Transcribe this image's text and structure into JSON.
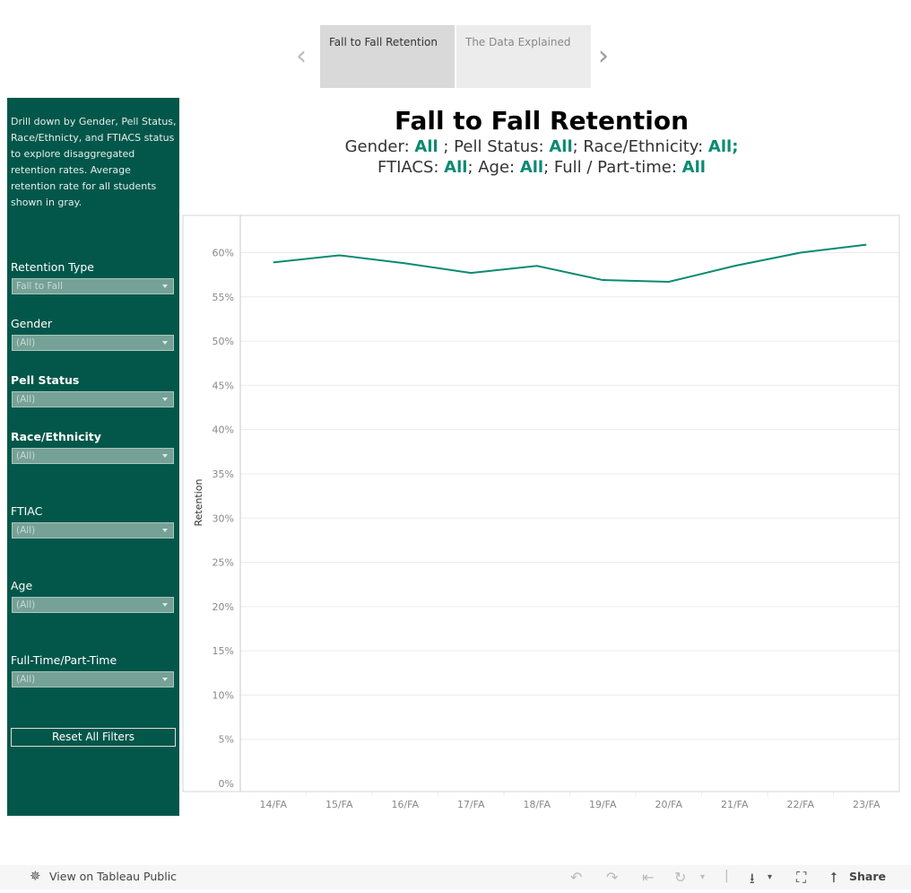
{
  "story": {
    "points": [
      {
        "label": "Fall to Fall Retention",
        "active": true
      },
      {
        "label": "The Data Explained",
        "active": false
      }
    ],
    "prev_icon": "chevron-left-icon",
    "next_icon": "chevron-right-icon"
  },
  "sidebar": {
    "description": "Drill down by Gender, Pell Status, Race/Ethnicty, and FTIACS status to explore disaggregated retention rates. Average retention rate for all students shown in gray.",
    "filters": [
      {
        "label": "Retention Type",
        "value": "Fall to Fall",
        "bold": false
      },
      {
        "label": "Gender",
        "value": "(All)",
        "bold": false
      },
      {
        "label": "Pell Status",
        "value": "(All)",
        "bold": true
      },
      {
        "label": "Race/Ethnicity",
        "value": "(All)",
        "bold": true
      },
      {
        "label": "FTIAC",
        "value": "(All)",
        "bold": false
      },
      {
        "label": "Age",
        "value": "(All)",
        "bold": false
      },
      {
        "label": "Full-Time/Part-Time",
        "value": "(All)",
        "bold": false
      }
    ],
    "reset_label": "Reset All Filters"
  },
  "header": {
    "title": "Fall to Fall Retention",
    "line1": [
      {
        "t": "Gender: ",
        "hl": false
      },
      {
        "t": "All",
        "hl": true
      },
      {
        "t": " ; Pell Status: ",
        "hl": false
      },
      {
        "t": "All",
        "hl": true
      },
      {
        "t": ";  Race/Ethnicity: ",
        "hl": false
      },
      {
        "t": "All",
        "hl": true
      },
      {
        "t": ";",
        "hl": true
      }
    ],
    "line2": [
      {
        "t": "FTIACS: ",
        "hl": false
      },
      {
        "t": "All",
        "hl": true
      },
      {
        "t": "; Age: ",
        "hl": false
      },
      {
        "t": "All",
        "hl": true
      },
      {
        "t": "; Full / Part-time: ",
        "hl": false
      },
      {
        "t": "All",
        "hl": true
      }
    ]
  },
  "colors": {
    "sidebar_bg": "#03574a",
    "line": "#0b8a72",
    "highlight": "#0b8a72"
  },
  "chart_data": {
    "type": "line",
    "title": "Fall to Fall Retention",
    "xlabel": "",
    "ylabel": "Retention",
    "categories": [
      "14/FA",
      "15/FA",
      "16/FA",
      "17/FA",
      "18/FA",
      "19/FA",
      "20/FA",
      "21/FA",
      "22/FA",
      "23/FA"
    ],
    "series": [
      {
        "name": "Retention",
        "values": [
          58.9,
          59.7,
          58.8,
          57.7,
          58.5,
          56.9,
          56.7,
          58.5,
          60.0,
          60.9
        ]
      }
    ],
    "yticks": [
      "0%",
      "5%",
      "10%",
      "15%",
      "20%",
      "25%",
      "30%",
      "35%",
      "40%",
      "45%",
      "50%",
      "55%",
      "60%"
    ],
    "ytick_values": [
      0,
      5,
      10,
      15,
      20,
      25,
      30,
      35,
      40,
      45,
      50,
      55,
      60
    ],
    "ylim": [
      0,
      64
    ],
    "grid": true,
    "legend": "none"
  },
  "footer": {
    "tableau_link": "View on Tableau Public",
    "share_label": "Share",
    "icons": [
      "undo-icon",
      "redo-icon",
      "revert-icon",
      "refresh-icon",
      "pause-dropdown-icon",
      "download-icon",
      "fullscreen-icon",
      "share-icon"
    ]
  }
}
